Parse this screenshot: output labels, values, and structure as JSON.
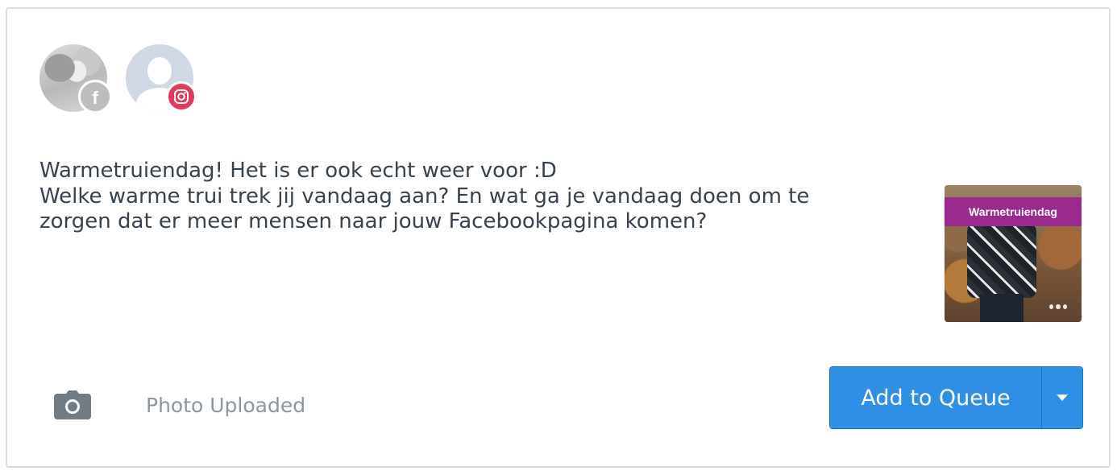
{
  "profiles": [
    {
      "network": "facebook",
      "badge_icon": "facebook-icon",
      "badge_glyph": "f",
      "badge_color": "#bdbdbd"
    },
    {
      "network": "instagram",
      "badge_icon": "instagram-icon",
      "badge_color": "#e03a5c"
    }
  ],
  "post": {
    "lines": [
      "Warmetruiendag! Het is er ook echt weer voor :D",
      "Welke warme trui trek jij vandaag aan? En wat ga je vandaag doen om te",
      "zorgen dat er meer mensen naar jouw Facebookpagina komen?"
    ],
    "thumbnail_banner": "Warmetruiendag"
  },
  "footer": {
    "media_icon": "camera-icon",
    "status": "Photo Uploaded",
    "primary_button": "Add to Queue",
    "dropdown_icon": "caret-down-icon",
    "accent_color": "#2e8fe5"
  }
}
